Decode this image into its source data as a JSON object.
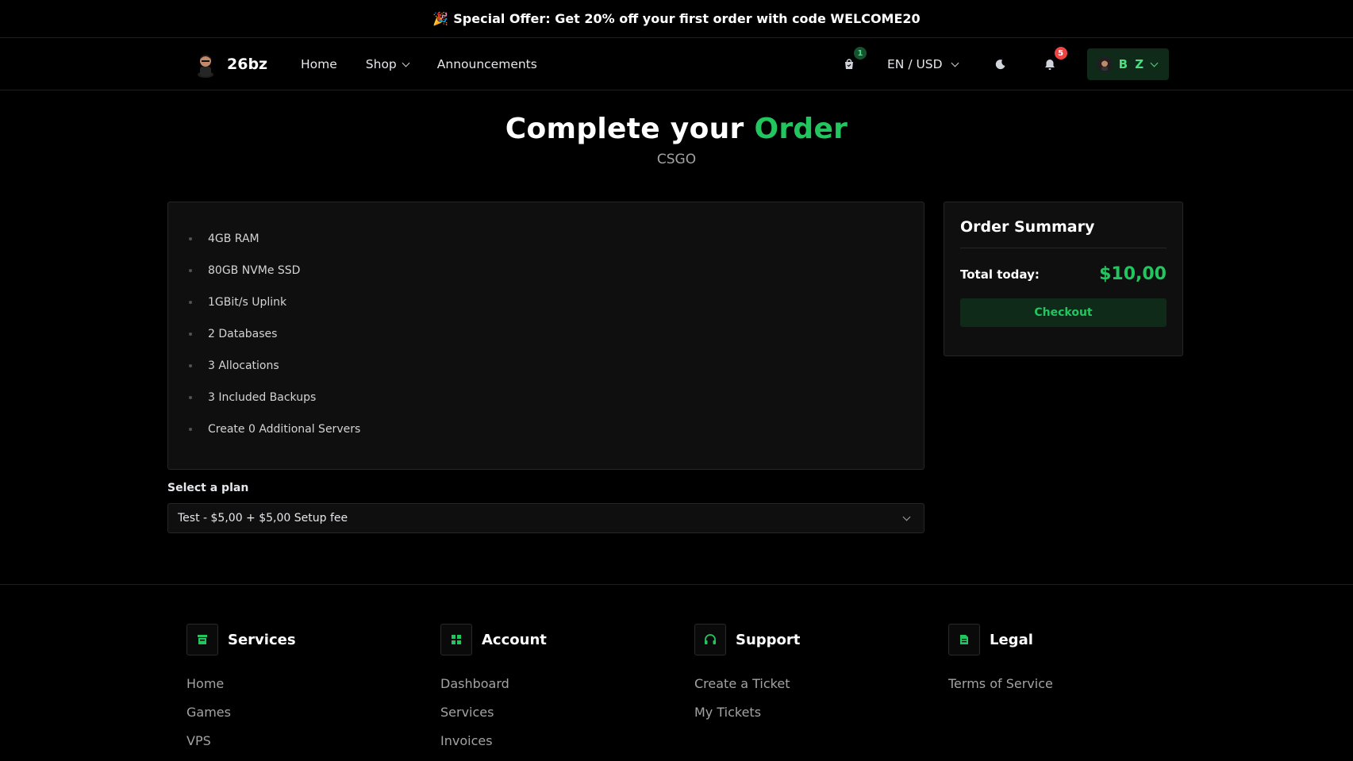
{
  "promo": {
    "emoji": "🎉",
    "text": "Special Offer: Get 20% off your first order with code WELCOME20"
  },
  "nav": {
    "brand": "26bz",
    "links": [
      "Home",
      "Shop",
      "Announcements"
    ],
    "cart_count": "1",
    "locale": "EN / USD",
    "notif_count": "5",
    "user_initials": "B Z"
  },
  "hero": {
    "title_prefix": "Complete your",
    "title_accent": "Order",
    "subtitle": "CSGO"
  },
  "features": [
    "4GB RAM",
    "80GB NVMe SSD",
    "1GBit/s Uplink",
    "2 Databases",
    "3 Allocations",
    "3 Included Backups",
    "Create 0 Additional Servers"
  ],
  "plan": {
    "label": "Select a plan",
    "selected": "Test - $5,00 + $5,00 Setup fee"
  },
  "summary": {
    "title": "Order Summary",
    "total_label": "Total today:",
    "total_value": "$10,00",
    "checkout_label": "Checkout"
  },
  "footer": {
    "columns": [
      {
        "title": "Services",
        "icon": "store-icon",
        "links": [
          "Home",
          "Games",
          "VPS"
        ]
      },
      {
        "title": "Account",
        "icon": "grid-icon",
        "links": [
          "Dashboard",
          "Services",
          "Invoices"
        ]
      },
      {
        "title": "Support",
        "icon": "headset-icon",
        "links": [
          "Create a Ticket",
          "My Tickets"
        ]
      },
      {
        "title": "Legal",
        "icon": "document-icon",
        "links": [
          "Terms of Service"
        ]
      }
    ]
  },
  "colors": {
    "accent": "#22c55e",
    "accent_bg": "#0f2a19",
    "badge_red": "#ef4444"
  }
}
